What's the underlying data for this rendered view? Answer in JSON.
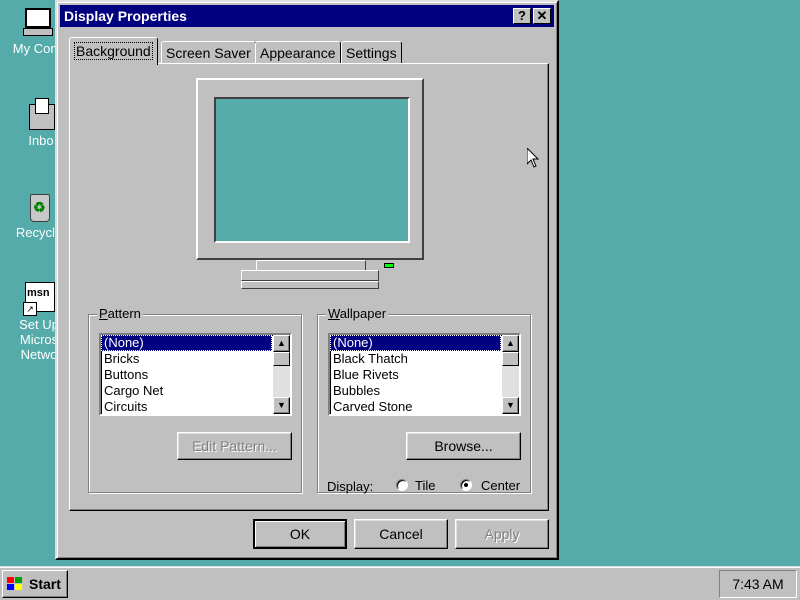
{
  "desktop": {
    "icons": [
      {
        "label": "My Com",
        "icon": "my-computer-icon"
      },
      {
        "label": "Inbo",
        "icon": "inbox-icon"
      },
      {
        "label": "Recycle",
        "icon": "recycle-bin-icon"
      },
      {
        "label_lines": [
          "Set Up",
          "Micros",
          "Netwo"
        ],
        "icon": "msn-icon",
        "tile_text": "msn"
      }
    ]
  },
  "window": {
    "title": "Display Properties",
    "help_glyph": "?",
    "close_glyph": "✕",
    "tabs": [
      "Background",
      "Screen Saver",
      "Appearance",
      "Settings"
    ],
    "active_tab": "Background"
  },
  "pattern": {
    "legend": "Pattern",
    "items": [
      "(None)",
      "Bricks",
      "Buttons",
      "Cargo Net",
      "Circuits"
    ],
    "selected": "(None)",
    "edit_button": "Edit Pattern..."
  },
  "wallpaper": {
    "legend": "Wallpaper",
    "items": [
      "(None)",
      "Black Thatch",
      "Blue Rivets",
      "Bubbles",
      "Carved Stone"
    ],
    "selected": "(None)",
    "browse_button": "Browse...",
    "display_label": "Display:",
    "options": [
      "Tile",
      "Center"
    ],
    "selected_option": "Center"
  },
  "buttons": {
    "ok": "OK",
    "cancel": "Cancel",
    "apply": "Apply"
  },
  "taskbar": {
    "start_label": "Start",
    "clock": "7:43 AM"
  },
  "colors": {
    "desktop": "#55aaaa",
    "titlebar": "#000080",
    "face": "#c0c0c0",
    "selection": "#000080"
  }
}
